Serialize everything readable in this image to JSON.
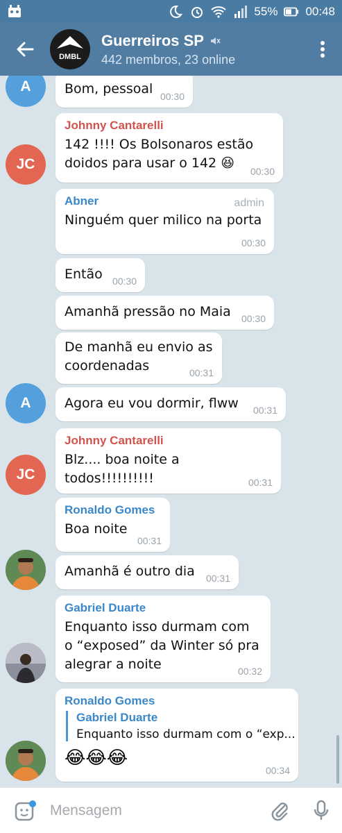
{
  "status_bar": {
    "battery": "55%",
    "time": "00:48"
  },
  "header": {
    "title": "Guerreiros SP",
    "subtitle": "442 membros, 23 online",
    "avatar_text": "DMBL"
  },
  "messages": [
    {
      "avatar": "A",
      "text": "Bom, pessoal",
      "time": "00:30"
    },
    {
      "avatar": "JC",
      "sender": "Johnny Cantarelli",
      "lines": [
        "142 !!!!  Os Bolsonaros estão",
        "doidos para usar o 142 😆"
      ],
      "time": "00:30"
    },
    {
      "sender": "Abner",
      "tag": "admin",
      "text": "Ninguém quer milico na porta",
      "time": "00:30"
    },
    {
      "text": "Então",
      "time": "00:30"
    },
    {
      "text": "Amanhã pressão no Maia",
      "time": "00:30"
    },
    {
      "lines": [
        "De manhã eu envio as",
        "coordenadas"
      ],
      "time": "00:31"
    },
    {
      "avatar": "A",
      "text": "Agora eu vou dormir, flww",
      "time": "00:31"
    },
    {
      "avatar": "JC",
      "sender": "Johnny Cantarelli",
      "text": "Blz.... boa noite a todos!!!!!!!!!!",
      "time": "00:31"
    },
    {
      "sender": "Ronaldo Gomes",
      "text": "Boa noite",
      "time": "00:31"
    },
    {
      "text": "Amanhã é outro dia",
      "time": "00:31"
    },
    {
      "sender": "Gabriel Duarte",
      "lines": [
        "Enquanto isso durmam com",
        "o “exposed” da Winter só pra",
        "alegrar a noite"
      ],
      "time": "00:32"
    },
    {
      "sender": "Ronaldo Gomes",
      "reply": {
        "name": "Gabriel Duarte",
        "text": "Enquanto isso durmam com o “exp..."
      },
      "emoji": "😂😂😂",
      "time": "00:34"
    }
  ],
  "input": {
    "placeholder": "Mensagem"
  },
  "colors": {
    "header": "#527da3",
    "status_bar": "#4a7ba3",
    "chat_bg": "#d9e4ea",
    "sender_johnny": "#d0534d",
    "sender_blue": "#3a87c9",
    "avatar_blue": "#54a0dd",
    "avatar_red": "#e26652"
  }
}
